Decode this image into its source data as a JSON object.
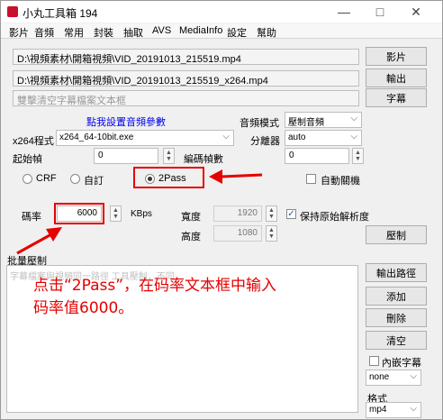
{
  "window": {
    "title": "小丸工具箱 194",
    "minimize_glyph": "—",
    "maximize_glyph": "□",
    "close_glyph": "✕"
  },
  "menu": [
    "影片",
    "音頻",
    "常用",
    "封裝",
    "抽取",
    "AVS",
    "MediaInfo",
    "設定",
    "幫助"
  ],
  "files": {
    "video_path": "D:\\視頻素材\\開箱視頻\\VID_20191013_215519.mp4",
    "output_path": "D:\\視頻素材\\開箱視頻\\VID_20191013_215519_x264.mp4",
    "subtitle_placeholder": "雙擊清空字幕檔案文本框",
    "video_button": "影片",
    "output_button": "輸出",
    "subtitle_button": "字幕"
  },
  "settings": {
    "audio_params_link": "點我設置音頻參數",
    "audio_mode_label": "音頻模式",
    "audio_mode_value": "壓制音頻",
    "x264_label": "x264程式",
    "x264_value": "x264_64-10bit.exe",
    "splitter_label": "分離器",
    "splitter_value": "auto",
    "start_frame_label": "起始幀",
    "start_frame_value": "0",
    "encode_frames_label": "編碼幀數",
    "encode_frames_value": "0",
    "mode_crf": "CRF",
    "mode_custom": "自訂",
    "mode_2pass": "2Pass",
    "auto_shutdown_label": "自動關機",
    "bitrate_label": "碼率",
    "bitrate_value": "6000",
    "bitrate_unit": "KBps",
    "width_label": "寬度",
    "width_value": "1920",
    "height_label": "高度",
    "height_value": "1080",
    "keep_resolution_label": "保持原始解析度",
    "encode_button": "壓制"
  },
  "batch": {
    "section_label": "批量壓制",
    "list_hint": "字幕檔案與視頻同一路徑 工具壓制，不同",
    "output_path_button": "輸出路徑",
    "add_button": "添加",
    "delete_button": "刪除",
    "clear_button": "清空",
    "embed_subtitle_label": "內嵌字幕",
    "embed_value": "none",
    "format_label": "格式",
    "format_value": "mp4"
  },
  "annotation": {
    "line1": "点击“2Pass”，在码率文本框中输入",
    "line2": "码率值6000。",
    "color": "#e60000"
  }
}
